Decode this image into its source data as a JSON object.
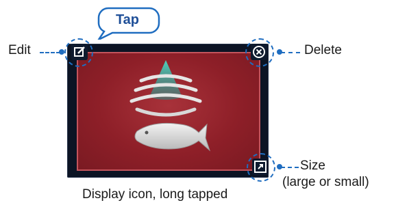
{
  "annotations": {
    "edit_label": "Edit",
    "delete_label": "Delete",
    "size_label": "Size",
    "size_sub_label": "(large or small)",
    "tap_label": "Tap"
  },
  "caption": "Display icon, long tapped",
  "icons": {
    "edit": "edit-icon",
    "delete": "delete-icon",
    "size": "resize-icon",
    "main": "fish-finder-icon"
  },
  "colors": {
    "tile_red": "#8e1f28",
    "frame_dark": "#0c1424",
    "callout_blue": "#1f6dc0",
    "sonar_teal": "#3fb8a8"
  }
}
